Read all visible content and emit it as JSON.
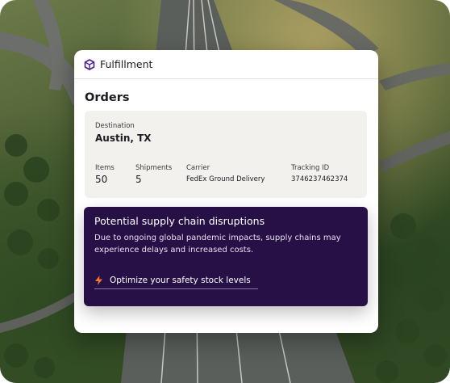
{
  "app": {
    "title": "Fulfillment",
    "logo_icon": "box-icon",
    "accent": "#5b2aa0"
  },
  "orders": {
    "title": "Orders",
    "destination_label": "Destination",
    "destination_value": "Austin, TX",
    "items_label": "Items",
    "items_value": "50",
    "shipments_label": "Shipments",
    "shipments_value": "5",
    "carrier_label": "Carrier",
    "carrier_value": "FedEx Ground Delivery",
    "tracking_label": "Tracking ID",
    "tracking_value": "3746237462374"
  },
  "alert": {
    "title": "Potential supply chain disruptions",
    "body": "Due to ongoing global pandemic impacts, supply chains may experience delays and increased costs.",
    "action_label": "Optimize your safety stock levels",
    "action_icon": "lightning-icon",
    "background": "#271046",
    "icon_color": "#f07a2a"
  }
}
